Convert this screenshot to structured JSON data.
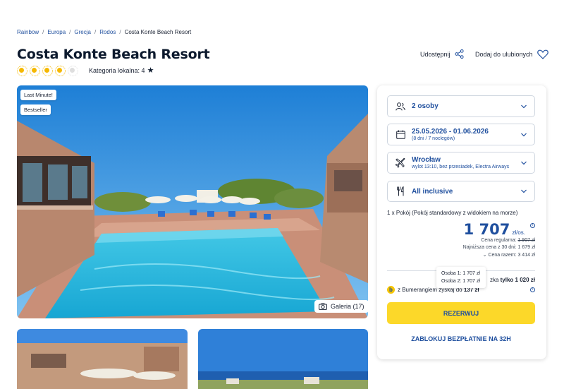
{
  "breadcrumb": {
    "items": [
      "Rainbow",
      "Europa",
      "Grecja",
      "Rodos"
    ],
    "current": "Costa Konte Beach Resort",
    "separator": "/"
  },
  "hotel": {
    "name": "Costa Konte Beach Resort",
    "rating_suns": 4,
    "rating_max": 5,
    "category_label": "Kategoria lokalna: 4"
  },
  "actions": {
    "share_label": "Udostępnij",
    "favorite_label": "Dodaj do ulubionych"
  },
  "photo": {
    "badges": [
      "Last Minute!",
      "Bestseller"
    ],
    "gallery_label": "Galeria (17)"
  },
  "booking": {
    "persons": "2 osoby",
    "dates": "25.05.2026 - 01.06.2026",
    "dates_sub": "(8 dni / 7 noclegów)",
    "departure": "Wrocław",
    "departure_sub": "wylot 13:10, bez przesiadek, Electra Airways",
    "board": "All inclusive",
    "room": "1 x Pokój  (Pokój standardowy z widokiem na morze)",
    "price": "1 707",
    "price_unit": "zł/os.",
    "regular_label": "Cena regularna:",
    "regular_price": "1 907 zł",
    "lowest_30": "Najniższa cena z 30 dni: 1 679 zł",
    "total": "Cena razem: 3 414 zł",
    "tooltip": [
      "Osoba 1: 1 707 zł",
      "Osoba 2: 1 707 zł"
    ],
    "promo_prefix": "zka",
    "promo_bold": "tylko 1 020 zł",
    "promo2_text": "z Bumerangiem zyskaj do",
    "promo2_bold": "137 zł",
    "reserve_label": "REZERWUJ",
    "block_label": "ZABLOKUJ BEZPŁATNIE NA 32H"
  },
  "colors": {
    "accent": "#1f4f9e",
    "cta": "#fcd829",
    "sun": "#f5b800"
  }
}
